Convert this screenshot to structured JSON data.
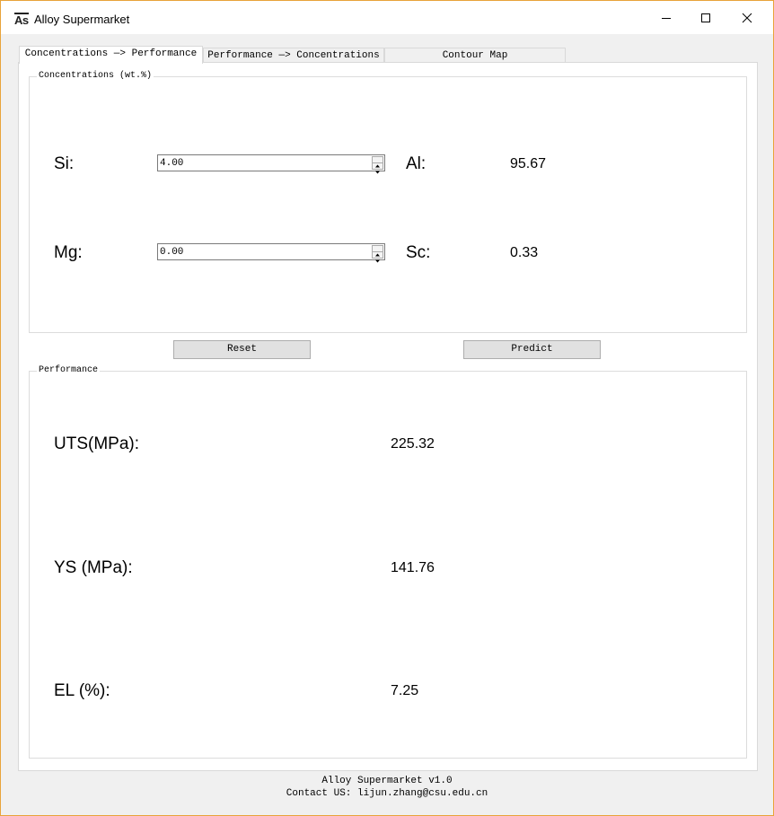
{
  "window": {
    "icon_text": "As",
    "title": "Alloy Supermarket"
  },
  "tabs": [
    {
      "label": "Concentrations —> Performance",
      "active": true
    },
    {
      "label": "Performance —> Concentrations",
      "active": false
    },
    {
      "label": "Contour Map",
      "active": false
    }
  ],
  "concentrations": {
    "group_title": "Concentrations (wt.%)",
    "si": {
      "label": "Si:",
      "value": "4.00"
    },
    "mg": {
      "label": "Mg:",
      "value": "0.00"
    },
    "al": {
      "label": "Al:",
      "value": "95.67"
    },
    "sc": {
      "label": "Sc:",
      "value": "0.33"
    }
  },
  "buttons": {
    "reset": "Reset",
    "predict": "Predict"
  },
  "performance": {
    "group_title": "Performance",
    "uts": {
      "label": "UTS(MPa):",
      "value": "225.32"
    },
    "ys": {
      "label": "YS (MPa):",
      "value": "141.76"
    },
    "el": {
      "label": "EL (%):",
      "value": "7.25"
    }
  },
  "footer": {
    "line1": "Alloy Supermarket v1.0",
    "line2": "Contact US: lijun.zhang@csu.edu.cn"
  }
}
